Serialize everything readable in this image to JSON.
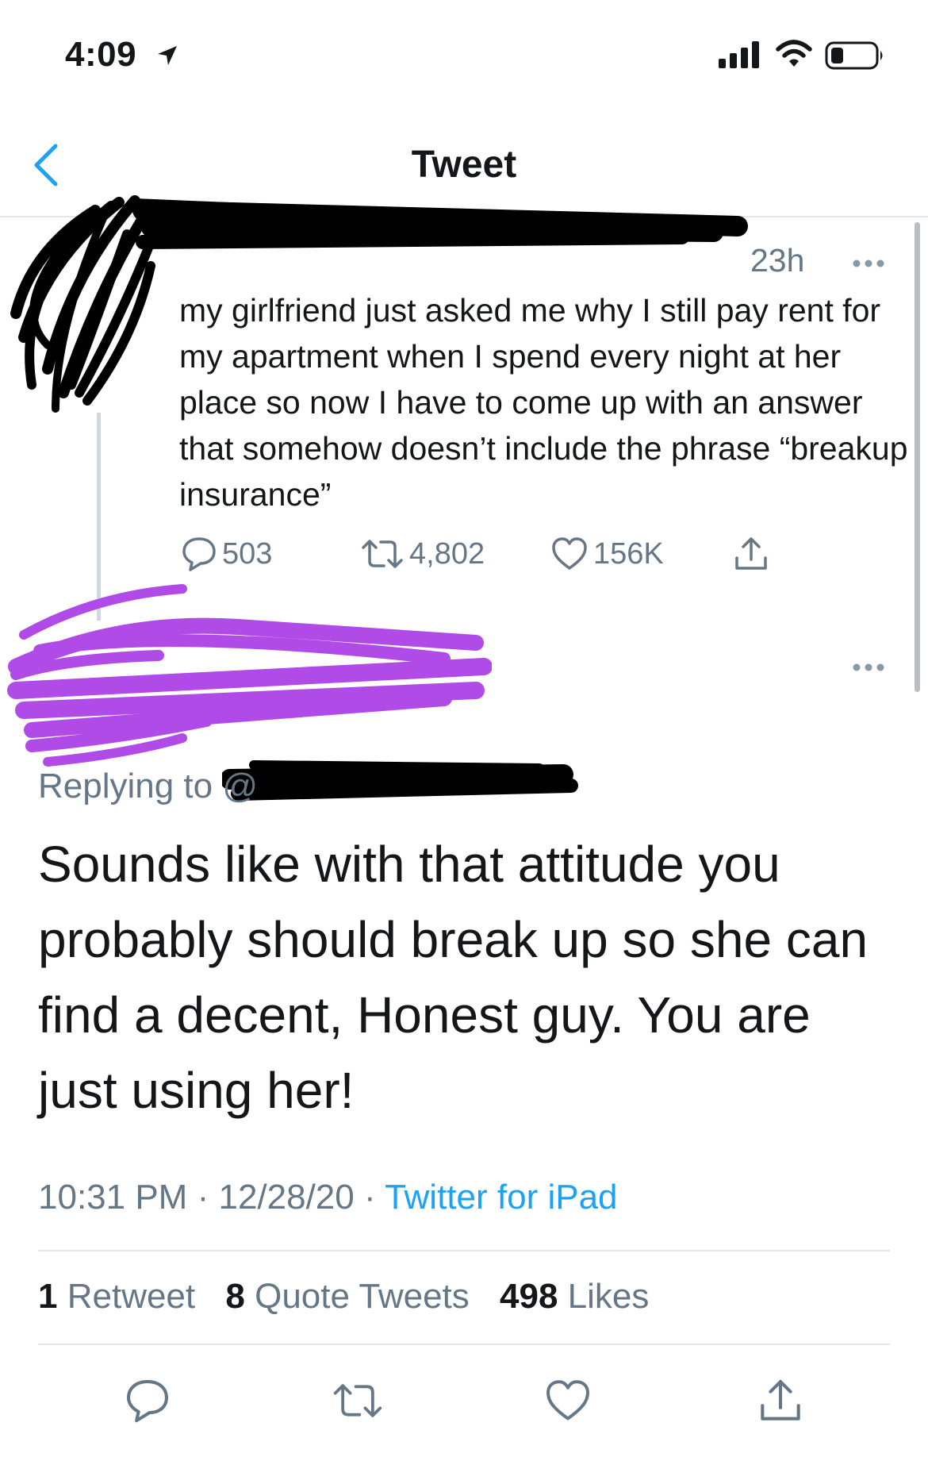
{
  "status_bar": {
    "time": "4:09",
    "icons": [
      "location-arrow-icon",
      "signal-icon",
      "wifi-icon",
      "battery-icon"
    ]
  },
  "nav": {
    "title": "Tweet",
    "back_icon": "chevron-left-icon"
  },
  "original_tweet": {
    "time_ago": "23h",
    "text": "my girlfriend just asked me why I still pay rent for my apartment when I spend every night at her place so now I have to come up with an answer that somehow doesn’t include the phrase “breakup insurance”",
    "replies": "503",
    "retweets": "4,802",
    "likes": "156K"
  },
  "reply_tweet": {
    "replying_to": "Replying to @",
    "text": "Sounds like with that attitude you probably should break up so she can find a decent, Honest guy. You are just using her!",
    "time": "10:31 PM",
    "date": "12/28/20",
    "separator": "·",
    "source": "Twitter for iPad",
    "stats": {
      "retweets_count": "1",
      "retweets_label": "Retweet",
      "quotes_count": "8",
      "quotes_label": "Quote Tweets",
      "likes_count": "498",
      "likes_label": "Likes"
    }
  },
  "colors": {
    "accent": "#1da1f2",
    "secondary_text": "#657786",
    "redaction_black": "#000000",
    "redaction_purple": "#b04be8"
  }
}
